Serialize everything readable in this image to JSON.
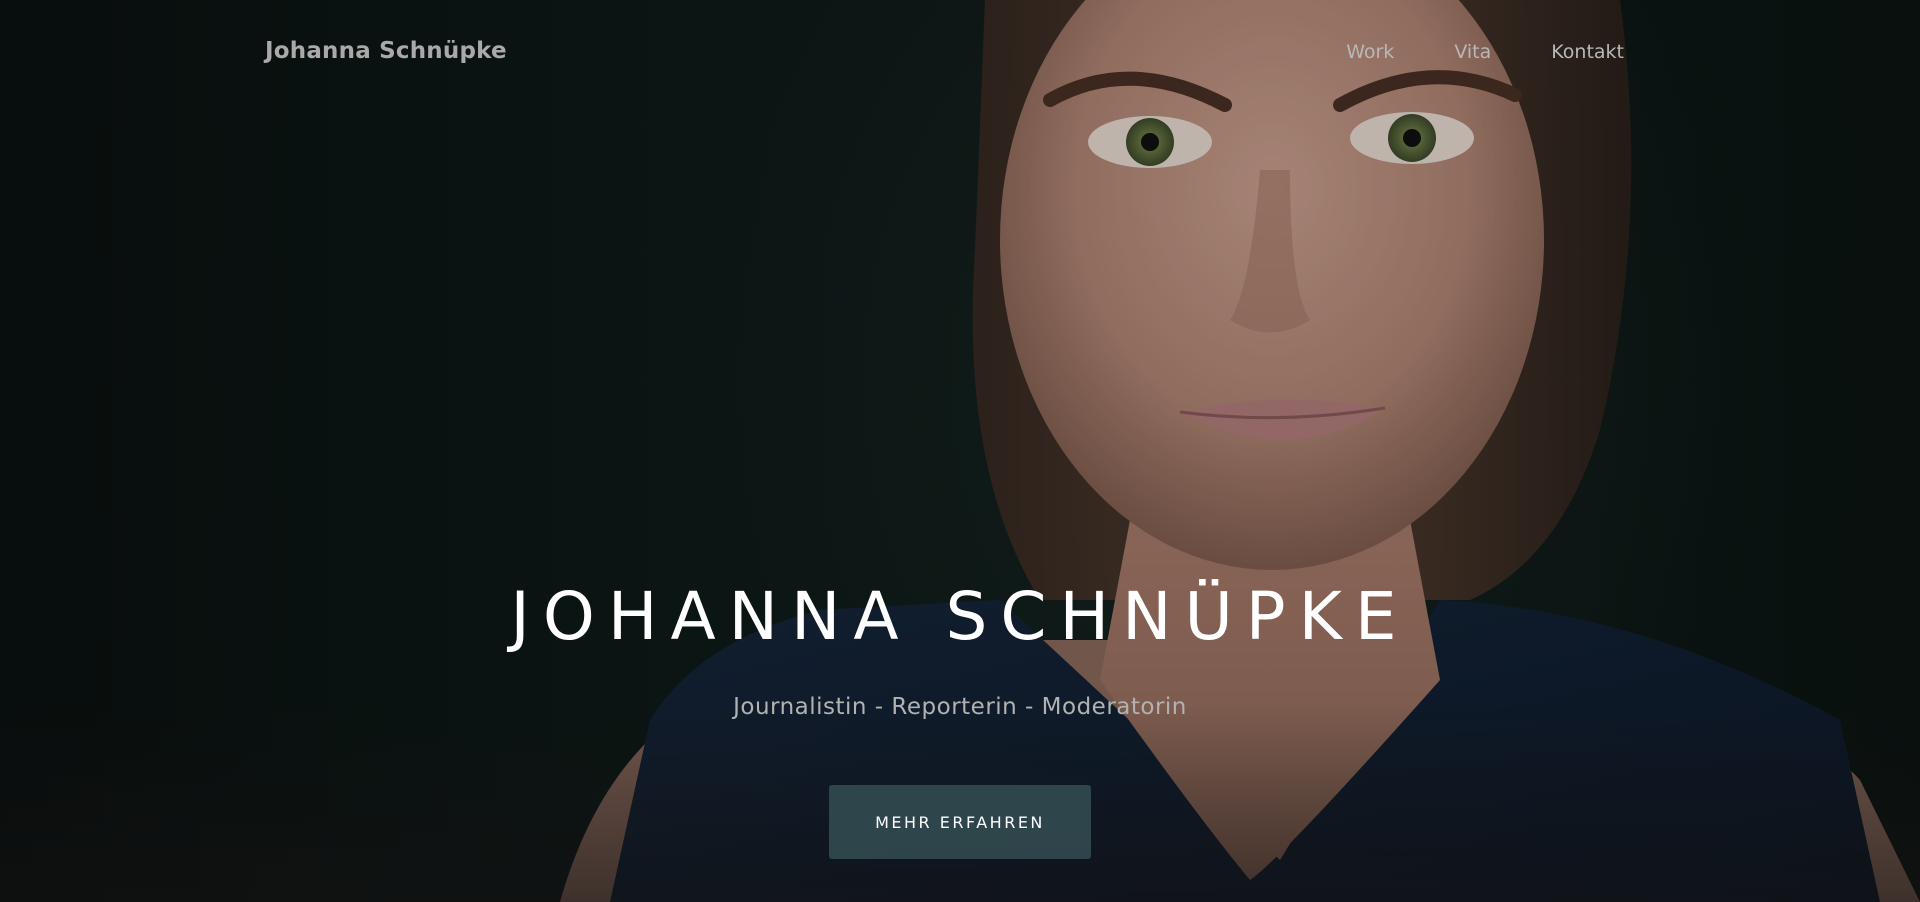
{
  "nav": {
    "brand": "Johanna Schnüpke",
    "items": [
      {
        "label": "Work"
      },
      {
        "label": "Vita"
      },
      {
        "label": "Kontakt"
      }
    ]
  },
  "hero": {
    "title": "JOHANNA SCHNÜPKE",
    "subtitle": "Journalistin - Reporterin - Moderatorin",
    "cta_label": "MEHR ERFAHREN"
  },
  "colors": {
    "background": "#0e1a18",
    "button": "#3a585c",
    "title_text": "#ffffff",
    "nav_text": "#b8b8b8"
  }
}
